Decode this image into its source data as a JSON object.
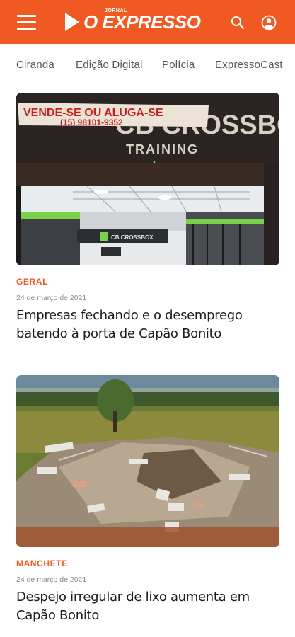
{
  "header": {
    "logo_small": "JORNAL",
    "logo_text": "O EXPRESSO",
    "brand_color": "#f05a22",
    "icons": [
      "menu-icon",
      "search-icon",
      "user-icon"
    ]
  },
  "nav": {
    "items": [
      {
        "label": "Ciranda"
      },
      {
        "label": "Edição Digital"
      },
      {
        "label": "Polícia"
      },
      {
        "label": "ExpressoCast"
      }
    ]
  },
  "articles": [
    {
      "category": "GERAL",
      "date": "24 de março de 2021",
      "title": "Empresas fechando e o desemprego batendo à porta de Capão Bonito",
      "image": {
        "banner_text": "VENDE-SE OU ALUGA-SE",
        "banner_phone": "(15) 98101-9352",
        "sign_text": "CB CROSSBOX",
        "sign_sub": "TRAINING",
        "inner_sign": "CB CROSSBOX"
      }
    },
    {
      "category": "MANCHETE",
      "date": "24 de março de 2021",
      "title": "Despejo irregular de lixo aumenta em Capão Bonito"
    }
  ]
}
